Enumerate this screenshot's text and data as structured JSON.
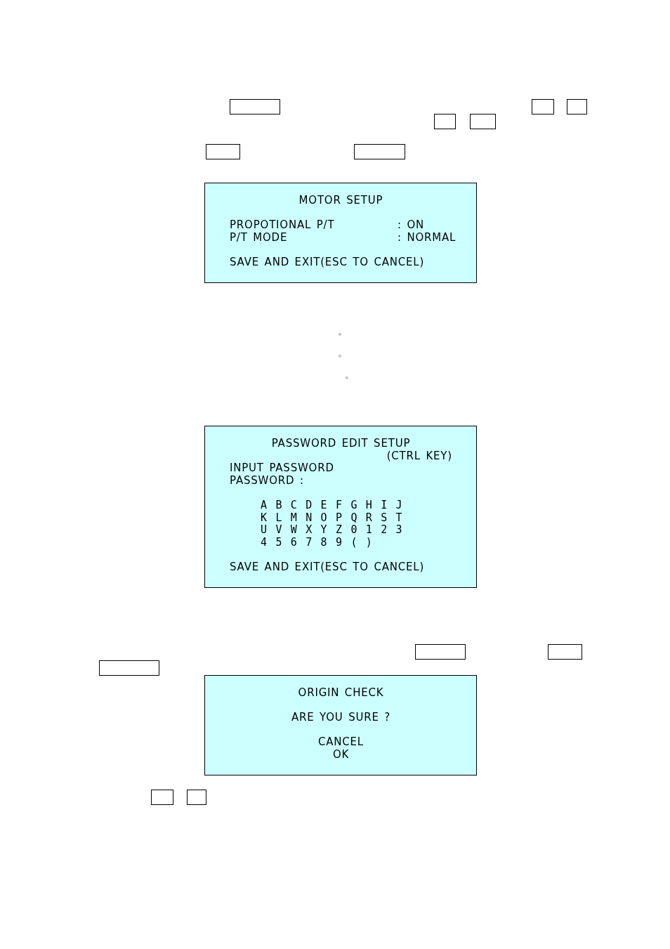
{
  "motor_setup_screen": {
    "title": "MOTOR SETUP",
    "rows": [
      {
        "label": "PROPOTIONAL P/T",
        "value": ": ON"
      },
      {
        "label": "P/T MODE",
        "value": ": NORMAL"
      }
    ],
    "footer": "SAVE AND EXIT(ESC TO CANCEL)"
  },
  "marks": [
    "。",
    "。",
    "。"
  ],
  "password_edit_screen": {
    "title": "PASSWORD EDIT SETUP",
    "subtitle": "(CTRL KEY)",
    "lines": [
      "INPUT PASSWORD",
      "PASSWORD :"
    ],
    "character_rows": [
      "A B C D E F G H I J",
      "K L M N O P Q R S T",
      "U V W X Y Z 0 1 2 3",
      "4 5 6 7 8 9 ( )"
    ],
    "footer": "SAVE AND EXIT(ESC TO CANCEL)"
  },
  "origin_check_screen": {
    "title": "ORIGIN CHECK",
    "question": "ARE YOU SURE ?",
    "options": [
      "CANCEL",
      "OK"
    ]
  }
}
